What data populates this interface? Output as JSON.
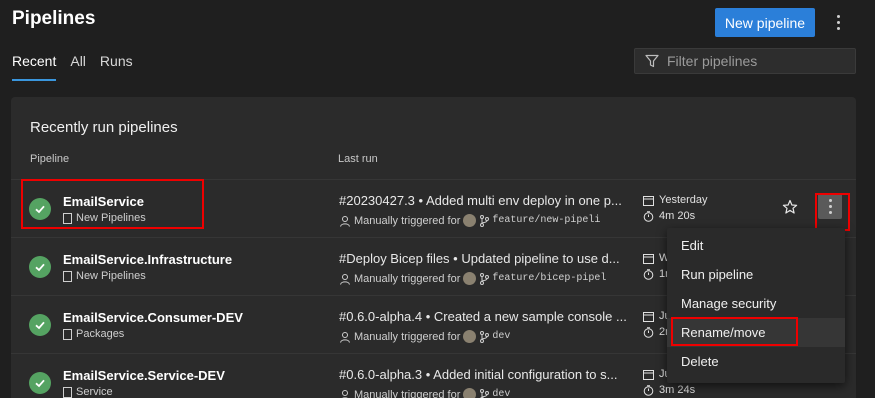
{
  "header": {
    "title": "Pipelines",
    "new_pipeline_label": "New pipeline"
  },
  "tabs": [
    {
      "label": "Recent",
      "active": true
    },
    {
      "label": "All",
      "active": false
    },
    {
      "label": "Runs",
      "active": false
    }
  ],
  "filter": {
    "placeholder": "Filter pipelines"
  },
  "card": {
    "title": "Recently run pipelines",
    "col_pipeline": "Pipeline",
    "col_last_run": "Last run"
  },
  "rows": [
    {
      "name": "EmailService",
      "folder": "New Pipelines",
      "run_title": "#20230427.3 • Added multi env deploy in one p...",
      "trigger": "Manually triggered for",
      "branch": "feature/new-pipeli",
      "date": "Yesterday",
      "duration": "4m 20s"
    },
    {
      "name": "EmailService.Infrastructure",
      "folder": "New Pipelines",
      "run_title": "#Deploy Bicep files • Updated pipeline to use d...",
      "trigger": "Manually triggered for",
      "branch": "feature/bicep-pipel",
      "date": "W",
      "duration": "1r"
    },
    {
      "name": "EmailService.Consumer-DEV",
      "folder": "Packages",
      "run_title": "#0.6.0-alpha.4 • Created a new sample console ...",
      "trigger": "Manually triggered for",
      "branch": "dev",
      "date": "Ju",
      "duration": "2r"
    },
    {
      "name": "EmailService.Service-DEV",
      "folder": "Service",
      "run_title": "#0.6.0-alpha.3 • Added initial configuration to s...",
      "trigger": "Manually triggered for",
      "branch": "dev",
      "date": "Ju",
      "duration": "3m 24s"
    }
  ],
  "context_menu": {
    "items": [
      "Edit",
      "Run pipeline",
      "Manage security",
      "Rename/move",
      "Delete"
    ]
  },
  "colors": {
    "accent": "#2b7fd9",
    "success": "#55a362",
    "highlight": "#ee0000"
  }
}
